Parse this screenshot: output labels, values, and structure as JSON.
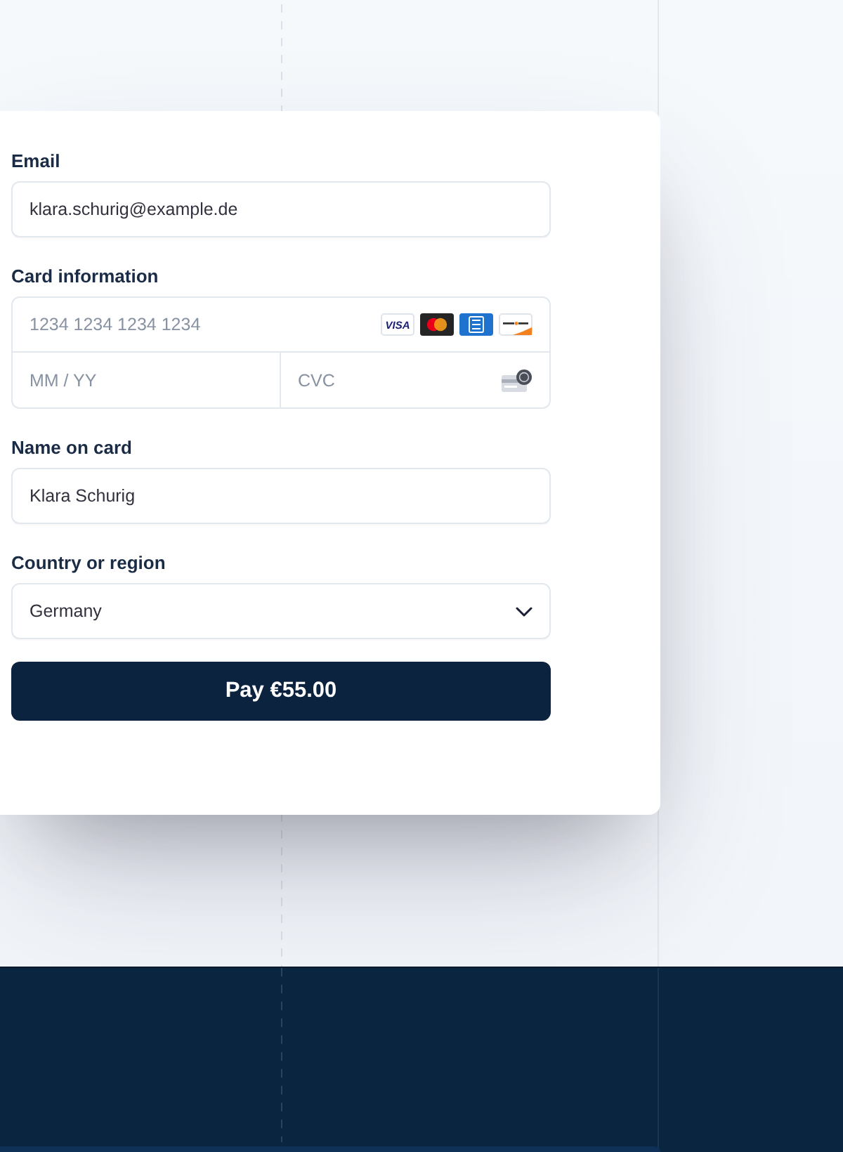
{
  "email": {
    "label": "Email",
    "value": "klara.schurig@example.de"
  },
  "card_information": {
    "label": "Card information",
    "number": {
      "placeholder": "1234 1234 1234 1234"
    },
    "card_brands": [
      {
        "kind": "visa",
        "text": "VISA"
      },
      {
        "kind": "mastercard"
      },
      {
        "kind": "amex"
      },
      {
        "kind": "discover"
      }
    ],
    "expiry": {
      "placeholder": "MM / YY"
    },
    "cvc": {
      "placeholder": "CVC"
    }
  },
  "name_on_card": {
    "label": "Name on card",
    "value": "Klara Schurig"
  },
  "country": {
    "label": "Country or region",
    "value": "Germany"
  },
  "pay_button": {
    "label": "Pay €55.00"
  }
}
